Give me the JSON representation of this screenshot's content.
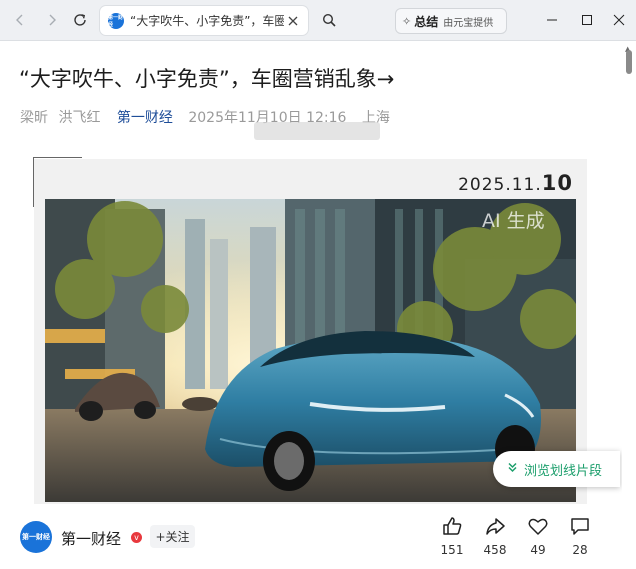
{
  "browser": {
    "nav": {
      "back_icon": "back-arrow-icon",
      "forward_icon": "forward-arrow-icon",
      "reload_icon": "reload-icon"
    },
    "tab": {
      "favicon_text": "第一财经",
      "title": "“大字吹牛、小字免责”，车圈营销乱象→",
      "close_icon": "close-icon"
    },
    "search_icon": "search-icon",
    "summary": {
      "label": "总结",
      "sub": "由元宝提供",
      "icon": "sparkle-icon"
    },
    "window": {
      "minimize_icon": "minimize-icon",
      "maximize_icon": "maximize-icon",
      "close_icon": "window-close-icon"
    }
  },
  "article": {
    "title": "“大字吹牛、小字免责”，车圈营销乱象→",
    "authors": [
      "梁昕",
      "洪飞红"
    ],
    "source": "第一财经",
    "date": "2025年11月10日 12:16",
    "location": "上海"
  },
  "image": {
    "date_prefix": "2025.11.",
    "date_day": "10",
    "watermark": "AI 生成"
  },
  "float_button": {
    "label": "浏览划线片段",
    "icon": "double-chevron-down-icon"
  },
  "footer": {
    "avatar_text": "第一财经",
    "publisher": "第一财经",
    "verified_mark": "v",
    "follow_label": "+关注",
    "actions": [
      {
        "name": "like",
        "icon": "thumbs-up-icon",
        "count": "151"
      },
      {
        "name": "share",
        "icon": "share-icon",
        "count": "458"
      },
      {
        "name": "favorite",
        "icon": "heart-icon",
        "count": "49"
      },
      {
        "name": "comment",
        "icon": "comment-icon",
        "count": "28"
      }
    ]
  },
  "colors": {
    "accent": "#1a73d9",
    "source_link": "#1f4e99",
    "float_green": "#1b9e6b",
    "verified_red": "#e8383d"
  }
}
